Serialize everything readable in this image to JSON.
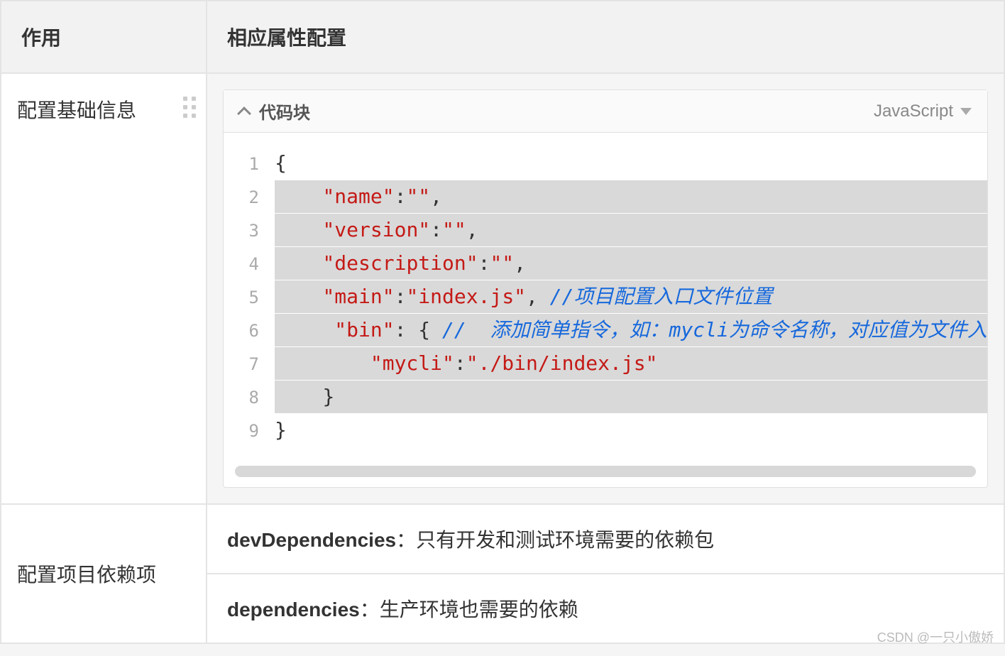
{
  "headers": {
    "col1": "作用",
    "col2": "相应属性配置"
  },
  "row1": {
    "left": "配置基础信息",
    "codeblock": {
      "title": "代码块",
      "language": "JavaScript",
      "lines": [
        {
          "n": "1",
          "segs": [
            {
              "t": "{",
              "c": "tok-punc"
            }
          ],
          "hl": false,
          "indent": 0
        },
        {
          "n": "2",
          "segs": [
            {
              "t": "\"name\"",
              "c": "tok-str"
            },
            {
              "t": ":",
              "c": "tok-punc"
            },
            {
              "t": "\"\"",
              "c": "tok-str"
            },
            {
              "t": ",",
              "c": "tok-punc"
            }
          ],
          "hl": true,
          "indent": 2
        },
        {
          "n": "3",
          "segs": [
            {
              "t": "\"version\"",
              "c": "tok-str"
            },
            {
              "t": ":",
              "c": "tok-punc"
            },
            {
              "t": "\"\"",
              "c": "tok-str"
            },
            {
              "t": ",",
              "c": "tok-punc"
            }
          ],
          "hl": true,
          "indent": 2
        },
        {
          "n": "4",
          "segs": [
            {
              "t": "\"description\"",
              "c": "tok-str"
            },
            {
              "t": ":",
              "c": "tok-punc"
            },
            {
              "t": "\"\"",
              "c": "tok-str"
            },
            {
              "t": ",",
              "c": "tok-punc"
            }
          ],
          "hl": true,
          "indent": 2
        },
        {
          "n": "5",
          "segs": [
            {
              "t": "\"main\"",
              "c": "tok-str"
            },
            {
              "t": ":",
              "c": "tok-punc"
            },
            {
              "t": "\"index.js\"",
              "c": "tok-str"
            },
            {
              "t": ", ",
              "c": "tok-punc"
            },
            {
              "t": "//项目配置入口文件位置",
              "c": "tok-cmt"
            }
          ],
          "hl": true,
          "indent": 2
        },
        {
          "n": "6",
          "segs": [
            {
              "t": " ",
              "c": "tok-punc"
            },
            {
              "t": "\"bin\"",
              "c": "tok-str"
            },
            {
              "t": ": { ",
              "c": "tok-punc"
            },
            {
              "t": "//  添加简单指令，如：mycli为命令名称，对应值为文件入口",
              "c": "tok-cmt"
            }
          ],
          "hl": true,
          "indent": 2
        },
        {
          "n": "7",
          "segs": [
            {
              "t": "\"mycli\"",
              "c": "tok-str"
            },
            {
              "t": ":",
              "c": "tok-punc"
            },
            {
              "t": "\"./bin/index.js\"",
              "c": "tok-str"
            }
          ],
          "hl": true,
          "indent": 4
        },
        {
          "n": "8",
          "segs": [
            {
              "t": "}",
              "c": "tok-punc"
            }
          ],
          "hl": true,
          "indent": 2
        },
        {
          "n": "9",
          "segs": [
            {
              "t": "}",
              "c": "tok-punc"
            }
          ],
          "hl": false,
          "indent": 0
        }
      ]
    }
  },
  "row2": {
    "left": "配置项目依赖项",
    "dev": {
      "key": "devDependencies",
      "desc": "：只有开发和测试环境需要的依赖包"
    },
    "dep": {
      "key": "dependencies",
      "desc": "：生产环境也需要的依赖"
    }
  },
  "watermark": "CSDN @一只小傲娇"
}
